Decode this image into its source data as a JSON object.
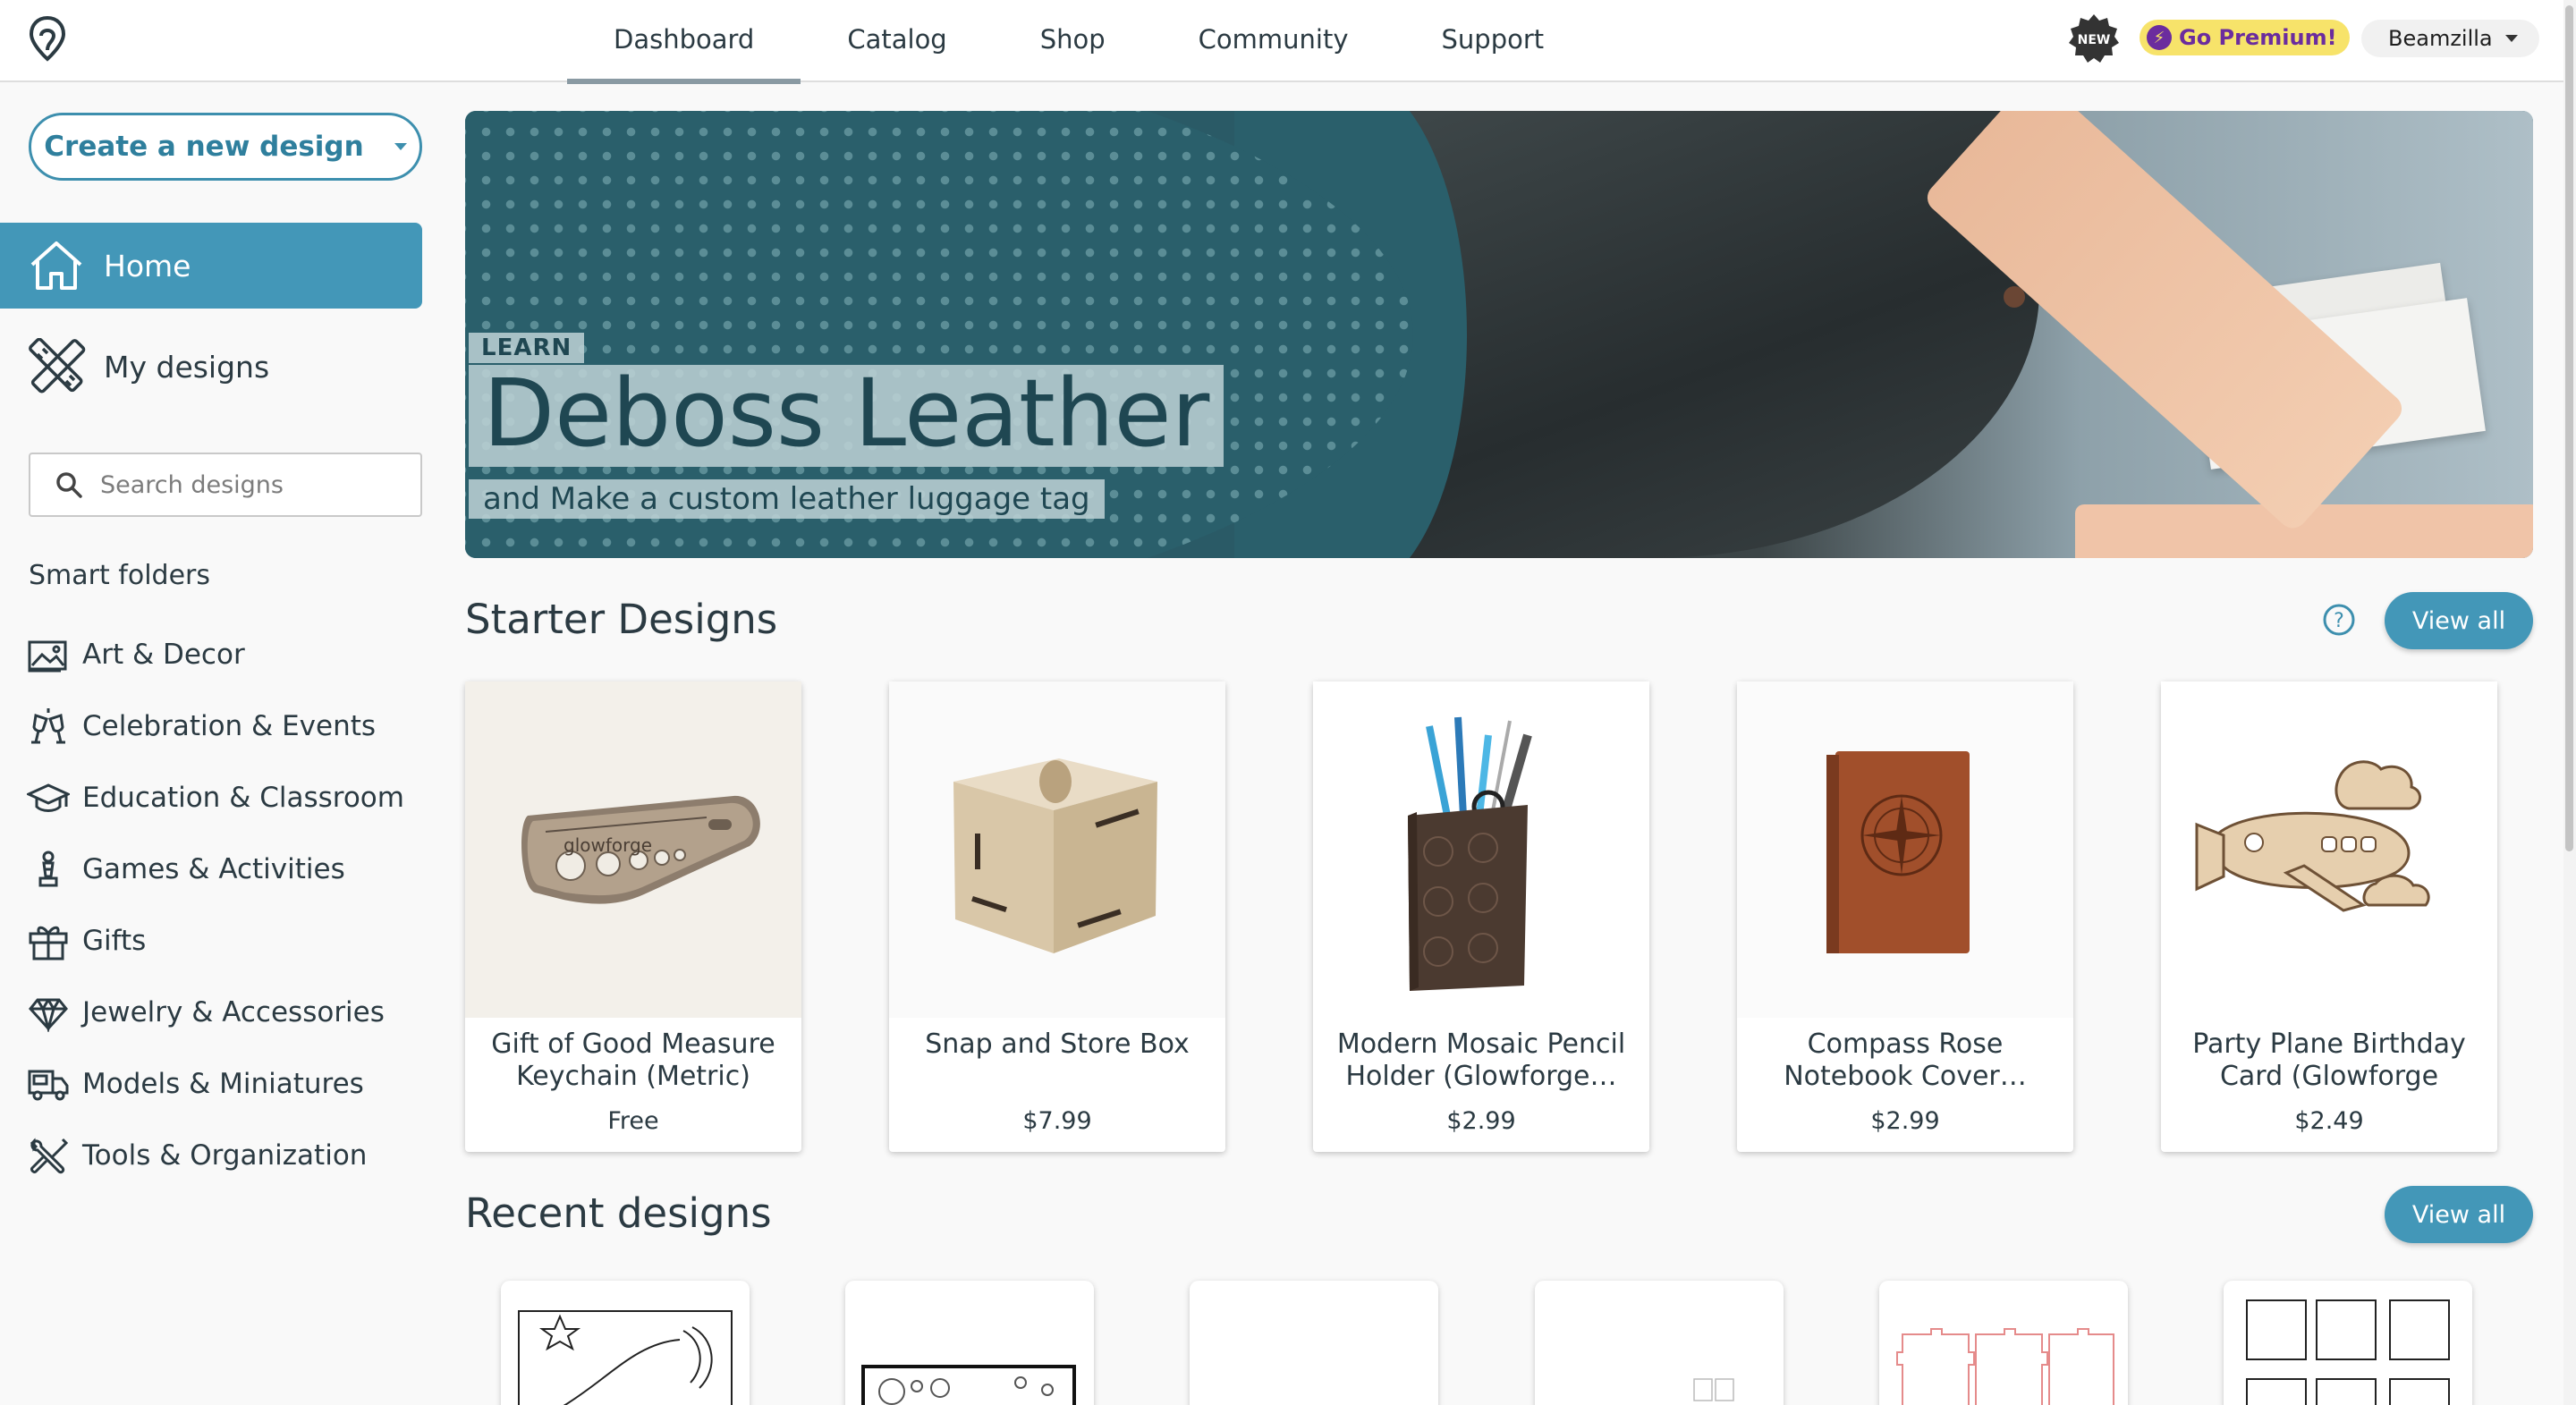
{
  "nav": {
    "tabs": [
      {
        "label": "Dashboard",
        "active": true
      },
      {
        "label": "Catalog",
        "active": false
      },
      {
        "label": "Shop",
        "active": false
      },
      {
        "label": "Community",
        "active": false
      },
      {
        "label": "Support",
        "active": false
      }
    ],
    "new_badge": "NEW",
    "premium_label": "Go Premium!",
    "username": "Beamzilla"
  },
  "sidebar": {
    "create_label": "Create a new design",
    "home_label": "Home",
    "my_designs_label": "My designs",
    "search_placeholder": "Search designs",
    "smart_folders_title": "Smart folders",
    "folders": [
      {
        "label": "Art & Decor",
        "icon": "image-icon"
      },
      {
        "label": "Celebration & Events",
        "icon": "glasses-toast-icon"
      },
      {
        "label": "Education & Classroom",
        "icon": "graduation-cap-icon"
      },
      {
        "label": "Games & Activities",
        "icon": "chess-piece-icon"
      },
      {
        "label": "Gifts",
        "icon": "gift-icon"
      },
      {
        "label": "Jewelry & Accessories",
        "icon": "diamond-icon"
      },
      {
        "label": "Models & Miniatures",
        "icon": "truck-icon"
      },
      {
        "label": "Tools & Organization",
        "icon": "tools-icon"
      }
    ]
  },
  "hero": {
    "kicker": "LEARN",
    "title": "Deboss Leather",
    "subtitle": "and Make a custom leather luggage tag"
  },
  "starter": {
    "title": "Starter Designs",
    "view_all": "View all",
    "items": [
      {
        "name": "Gift of Good Measure Keychain (Metric)",
        "price": "Free"
      },
      {
        "name": "Snap and Store Box",
        "price": "$7.99"
      },
      {
        "name": "Modern Mosaic Pencil Holder (Glowforge…",
        "price": "$2.99"
      },
      {
        "name": "Compass Rose Notebook Cover…",
        "price": "$2.99"
      },
      {
        "name": "Party Plane Birthday Card (Glowforge Laun…",
        "price": "$2.49"
      }
    ]
  },
  "recent": {
    "title": "Recent designs",
    "view_all": "View all"
  },
  "colors": {
    "accent": "#4397b8",
    "hero_teal": "#2a5f6b",
    "premium_bg": "#f7e36a",
    "premium_text": "#6b2c9e"
  }
}
